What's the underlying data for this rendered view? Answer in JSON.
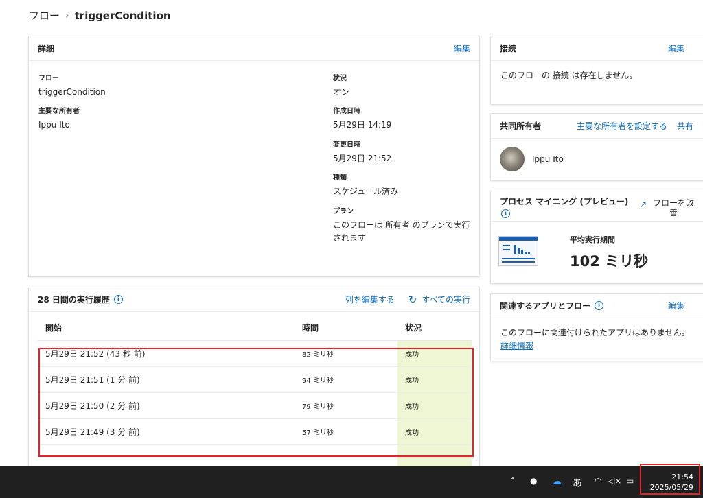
{
  "breadcrumb": {
    "root": "フロー",
    "separator": "›",
    "current": "triggerCondition"
  },
  "details": {
    "title": "詳細",
    "edit": "編集",
    "flow_label": "フロー",
    "flow_value": "triggerCondition",
    "owner_label": "主要な所有者",
    "owner_value": "Ippu Ito",
    "status_label": "状況",
    "status_value": "オン",
    "created_label": "作成日時",
    "created_value": "5月29日 14:19",
    "modified_label": "変更日時",
    "modified_value": "5月29日 21:52",
    "type_label": "種類",
    "type_value": "スケジュール済み",
    "plan_label": "プラン",
    "plan_value": "このフローは 所有者 のプランで実行されます"
  },
  "history": {
    "title": "28 日間の実行履歴",
    "edit_columns": "列を編集する",
    "all_runs": "すべての実行",
    "columns": {
      "start": "開始",
      "duration": "時間",
      "status": "状況"
    },
    "rows": [
      {
        "start": "5月29日 21:52 (43 秒 前)",
        "duration": "82 ミリ秒",
        "status": "成功"
      },
      {
        "start": "5月29日 21:51 (1 分 前)",
        "duration": "94 ミリ秒",
        "status": "成功"
      },
      {
        "start": "5月29日 21:50 (2 分 前)",
        "duration": "79 ミリ秒",
        "status": "成功"
      },
      {
        "start": "5月29日 21:49 (3 分 前)",
        "duration": "57 ミリ秒",
        "status": "成功"
      }
    ]
  },
  "connections": {
    "title": "接続",
    "edit": "編集",
    "message": "このフローの 接続 は存在しません。"
  },
  "coowners": {
    "title": "共同所有者",
    "set_owner": "主要な所有者を設定する",
    "share": "共有",
    "person": "Ippu Ito"
  },
  "mining": {
    "title": "プロセス マイニング (プレビュー)",
    "improve": "フローを改善",
    "metric_label": "平均実行期間",
    "metric_value": "102 ミリ秒"
  },
  "related": {
    "title": "関連するアプリとフロー",
    "edit": "編集",
    "message": "このフローに関連付けられたアプリはありません。",
    "more": "詳細情報"
  },
  "taskbar": {
    "ime": "あ",
    "time": "21:54",
    "date": "2025/05/29"
  },
  "colors": {
    "accent": "#0f6cbd",
    "success_bg": "#eef6d3",
    "highlight": "#e3242b",
    "taskbar": "#202020"
  }
}
